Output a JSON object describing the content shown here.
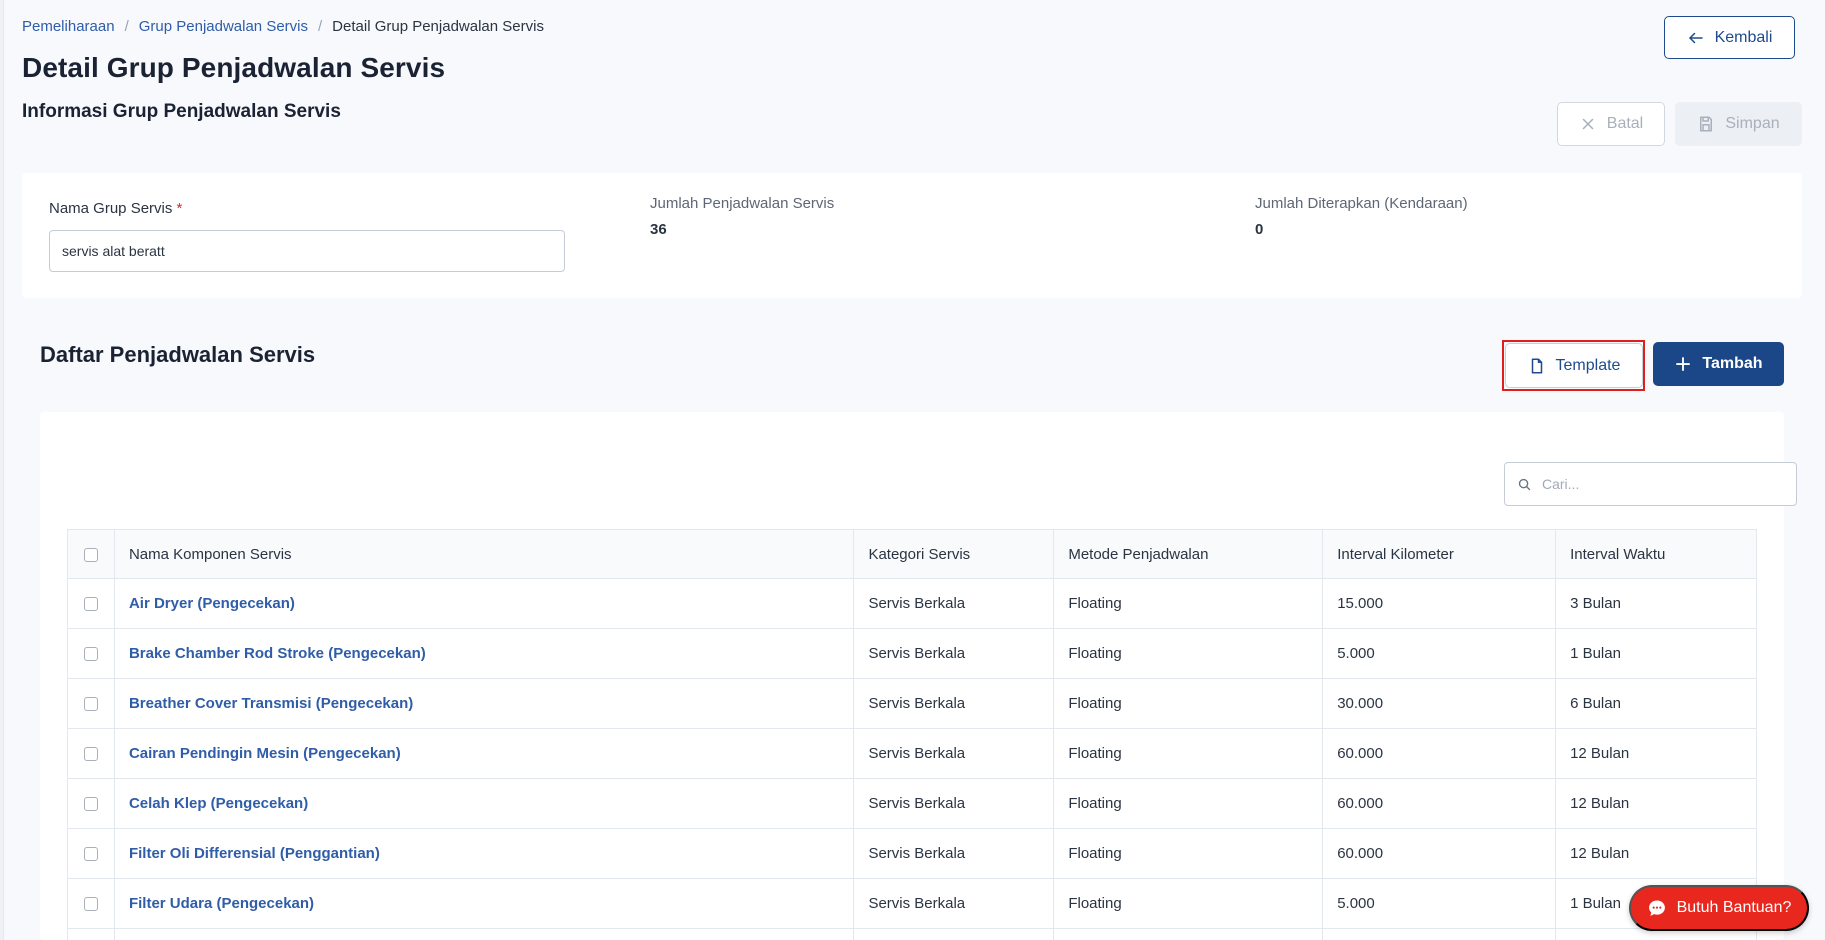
{
  "breadcrumb": {
    "items": [
      "Pemeliharaan",
      "Grup Penjadwalan Servis"
    ],
    "current": "Detail Grup Penjadwalan Servis"
  },
  "page_title": "Detail Grup Penjadwalan Servis",
  "section_title": "Informasi Grup Penjadwalan Servis",
  "actions": {
    "back_label": "Kembali",
    "cancel_label": "Batal",
    "save_label": "Simpan"
  },
  "form": {
    "name_label": "Nama Grup Servis",
    "required_mark": "*",
    "name_value": "servis alat beratt",
    "stats": [
      {
        "label": "Jumlah Penjadwalan Servis",
        "value": "36"
      },
      {
        "label": "Jumlah Diterapkan (Kendaraan)",
        "value": "0"
      }
    ]
  },
  "list": {
    "title": "Daftar Penjadwalan Servis",
    "template_label": "Template",
    "add_label": "Tambah",
    "search_placeholder": "Cari..."
  },
  "table": {
    "columns": [
      "Nama Komponen Servis",
      "Kategori Servis",
      "Metode Penjadwalan",
      "Interval Kilometer",
      "Interval Waktu"
    ],
    "rows": [
      [
        "Air Dryer (Pengecekan)",
        "Servis Berkala",
        "Floating",
        "15.000",
        "3 Bulan"
      ],
      [
        "Brake Chamber Rod Stroke (Pengecekan)",
        "Servis Berkala",
        "Floating",
        "5.000",
        "1 Bulan"
      ],
      [
        "Breather Cover Transmisi (Pengecekan)",
        "Servis Berkala",
        "Floating",
        "30.000",
        "6 Bulan"
      ],
      [
        "Cairan Pendingin Mesin (Pengecekan)",
        "Servis Berkala",
        "Floating",
        "60.000",
        "12 Bulan"
      ],
      [
        "Celah Klep (Pengecekan)",
        "Servis Berkala",
        "Floating",
        "60.000",
        "12 Bulan"
      ],
      [
        "Filter Oli Differensial (Penggantian)",
        "Servis Berkala",
        "Floating",
        "60.000",
        "12 Bulan"
      ],
      [
        "Filter Udara (Pengecekan)",
        "Servis Berkala",
        "Floating",
        "5.000",
        "1 Bulan"
      ],
      [
        "",
        "",
        "",
        "",
        ""
      ]
    ]
  },
  "help": {
    "label": "Butuh Bantuan?"
  },
  "icons": {
    "back": "arrow-left-icon",
    "cancel": "close-icon",
    "save": "save-icon",
    "template": "file-icon",
    "add": "plus-icon",
    "search": "search-icon",
    "help": "chat-icon"
  },
  "colors": {
    "primary": "#1b4789",
    "link": "#2f5da8",
    "help": "#e8281e",
    "highlight": "#e01e1e"
  }
}
